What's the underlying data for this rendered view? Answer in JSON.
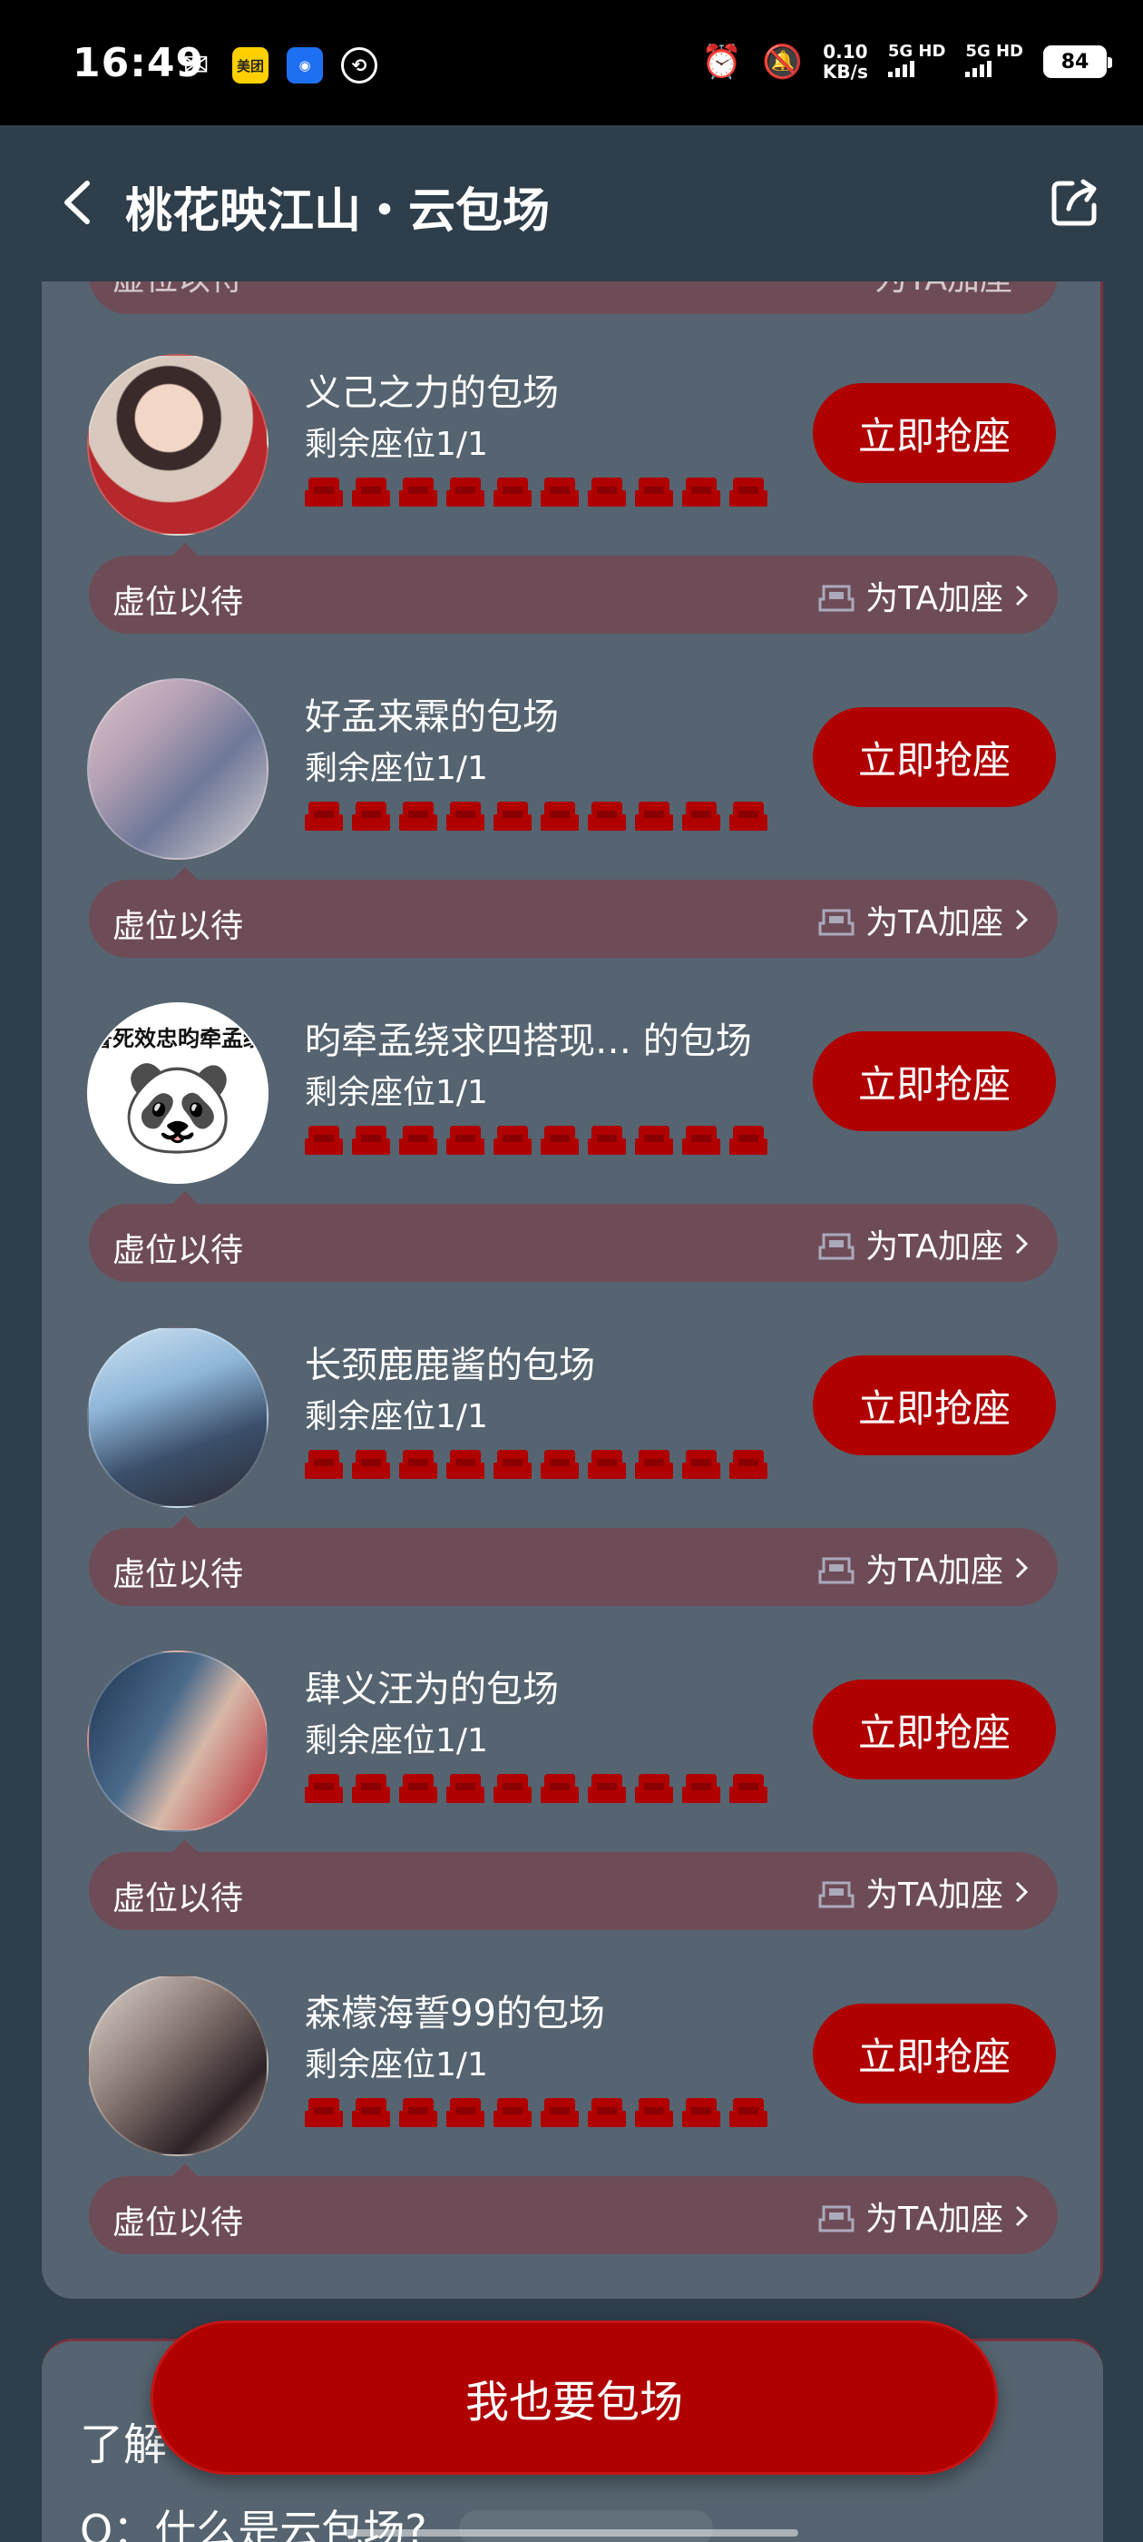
{
  "status_bar": {
    "time": "16:49",
    "speed_value": "0.10",
    "speed_unit": "KB/s",
    "signal1": "5G HD",
    "signal2": "5G HD",
    "battery": "84",
    "meituan_label": "美团"
  },
  "header": {
    "title": "桃花映江山・云包场"
  },
  "partial_item": {
    "wait_label": "虚位以待",
    "add_seat_label": "为TA加座"
  },
  "items": [
    {
      "name": "义己之力的包场",
      "seats": "剩余座位1/1",
      "button": "立即抢座",
      "wait_label": "虚位以待",
      "add_seat_label": "为TA加座"
    },
    {
      "name": "好孟来霖的包场",
      "seats": "剩余座位1/1",
      "button": "立即抢座",
      "wait_label": "虚位以待",
      "add_seat_label": "为TA加座"
    },
    {
      "name": "昀牵孟绕求四搭现… 的包场",
      "seats": "剩余座位1/1",
      "button": "立即抢座",
      "wait_label": "虚位以待",
      "add_seat_label": "为TA加座",
      "avatar_text": "誓死效忠昀牵孟绕"
    },
    {
      "name": "长颈鹿鹿酱的包场",
      "seats": "剩余座位1/1",
      "button": "立即抢座",
      "wait_label": "虚位以待",
      "add_seat_label": "为TA加座"
    },
    {
      "name": "肆义汪为的包场",
      "seats": "剩余座位1/1",
      "button": "立即抢座",
      "wait_label": "虚位以待",
      "add_seat_label": "为TA加座"
    },
    {
      "name": "森檬海誓99的包场",
      "seats": "剩余座位1/1",
      "button": "立即抢座",
      "wait_label": "虚位以待",
      "add_seat_label": "为TA加座"
    }
  ],
  "faq": {
    "heading": "了解",
    "question": "Q：什么是云包场?"
  },
  "primary_button": "我也要包场",
  "colors": {
    "background": "#2f3e4b",
    "card": "#556470",
    "accent_red": "#b00000",
    "wait_bar": "#6e4c57"
  }
}
